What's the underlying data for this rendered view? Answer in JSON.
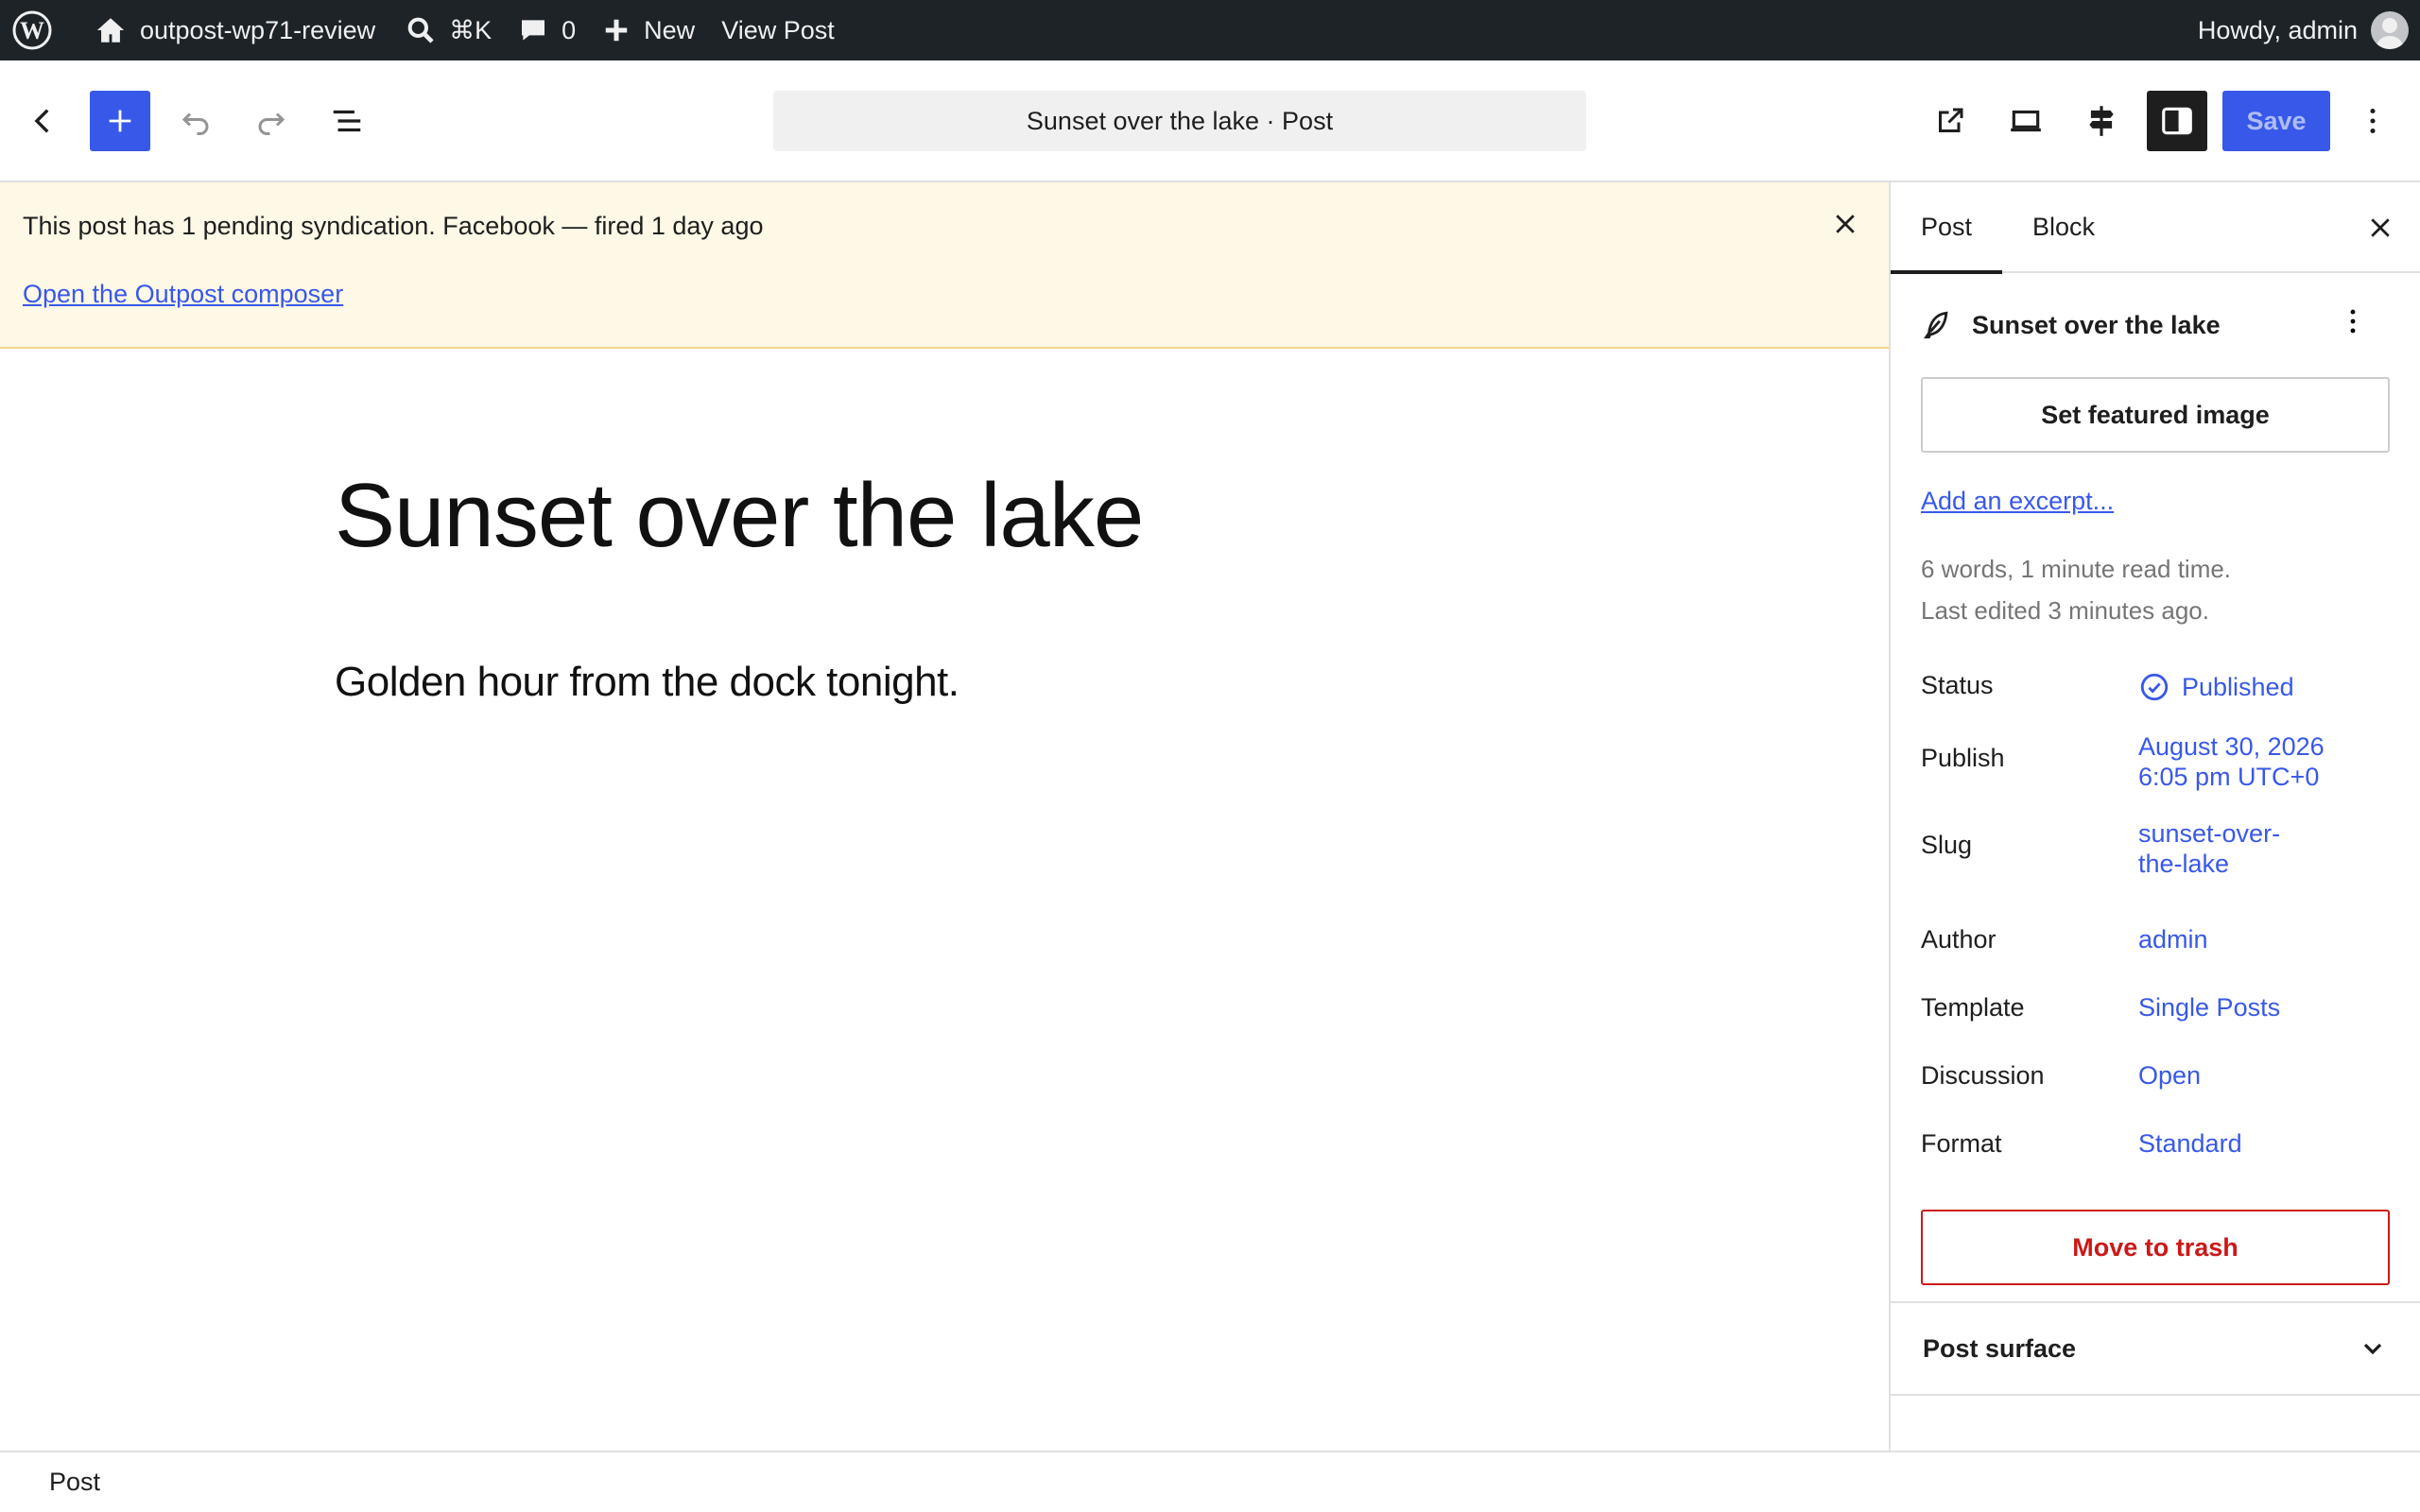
{
  "adminbar": {
    "wp_logo_icon": "wordpress-logo-icon",
    "site_name": "outpost-wp71-review",
    "search_shortcut": "⌘K",
    "comments_count": "0",
    "new_label": "New",
    "view_post_label": "View Post",
    "howdy": "Howdy, admin"
  },
  "header": {
    "document_title": "Sunset over the lake · Post",
    "save_label": "Save",
    "accent_color": "#3858e9"
  },
  "notice": {
    "message": "This post has 1 pending syndication. Facebook — fired 1 day ago",
    "link": "Open the Outpost composer"
  },
  "editor": {
    "title": "Sunset over the lake",
    "paragraph": "Golden hour from the dock tonight."
  },
  "sidebar": {
    "tabs": [
      {
        "label": "Post",
        "active": true
      },
      {
        "label": "Block",
        "active": false
      }
    ],
    "post_card_title": "Sunset over the lake",
    "featured_image_label": "Set featured image",
    "excerpt_link": "Add an excerpt...",
    "stats_words": "6 words, 1 minute read time.",
    "stats_edited": "Last edited 3 minutes ago.",
    "rows": {
      "status": {
        "label": "Status",
        "value": "Published"
      },
      "publish": {
        "label": "Publish",
        "value_line1": "August 30, 2026",
        "value_line2": "6:05 pm UTC+0"
      },
      "slug": {
        "label": "Slug",
        "value_line1": "sunset-over-",
        "value_line2": "the-lake"
      },
      "author": {
        "label": "Author",
        "value": "admin"
      },
      "template": {
        "label": "Template",
        "value": "Single Posts"
      },
      "discussion": {
        "label": "Discussion",
        "value": "Open"
      },
      "format": {
        "label": "Format",
        "value": "Standard"
      }
    },
    "trash_label": "Move to trash",
    "surface_label": "Post surface"
  },
  "footer": {
    "breadcrumb": "Post"
  }
}
